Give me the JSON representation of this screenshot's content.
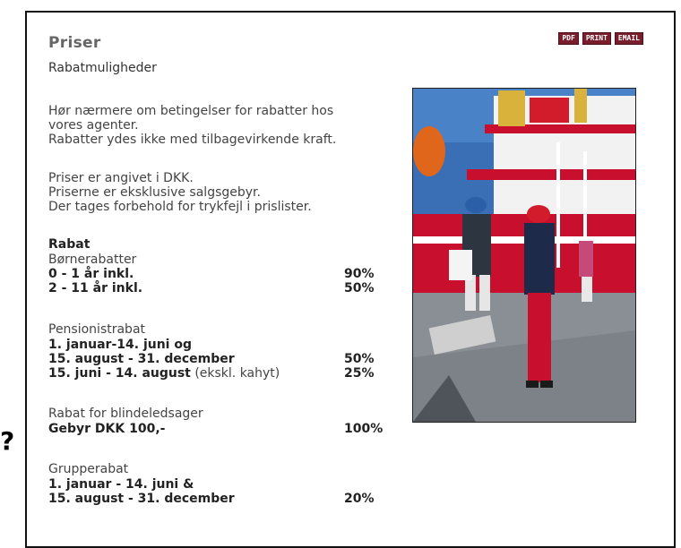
{
  "page": {
    "title": "Priser",
    "subtitle": "Rabatmuligheder",
    "side_mark": "?"
  },
  "actions": {
    "pdf": "PDF",
    "print": "PRINT",
    "email": "EMAIL"
  },
  "intro": [
    "Hør nærmere om betingelser for rabatter hos",
    "vores agenter.",
    "Rabatter ydes ikke med tilbagevirkende kraft."
  ],
  "notes": [
    "Priser er angivet i DKK.",
    "Priserne er eksklusive salgsgebyr.",
    "Der tages forbehold for trykfejl i prislister."
  ],
  "rabat": {
    "heading": "Rabat",
    "children": {
      "caption": "Børnerabatter",
      "rows": [
        {
          "label": "0 - 1 år inkl.",
          "pct": "90%"
        },
        {
          "label": "2 - 11 år inkl.",
          "pct": "50%"
        }
      ]
    },
    "pension": {
      "caption": "Pensionistrabat",
      "line1": "1. januar-14. juni og",
      "line2": "15. august - 31. december",
      "line2_pct": "50%",
      "line3": "15. juni - 14. august",
      "line3_note": " (ekskl. kahyt)",
      "line3_pct": "25%"
    },
    "blind": {
      "caption": "Rabat for blindeledsager",
      "label": "Gebyr DKK 100,-",
      "pct": "100%"
    },
    "group": {
      "caption": "Grupperabat",
      "line1": "1. januar - 14. juni &",
      "line2": "15. august - 31. december",
      "line2_pct": "20%"
    }
  },
  "image": {
    "depicts": "passengers-disembarking-ship-photo",
    "colors": {
      "sky": "#3a6fb5",
      "hull": "#c8102e",
      "deck": "#ffffff",
      "quay": "#8a8f96"
    }
  }
}
